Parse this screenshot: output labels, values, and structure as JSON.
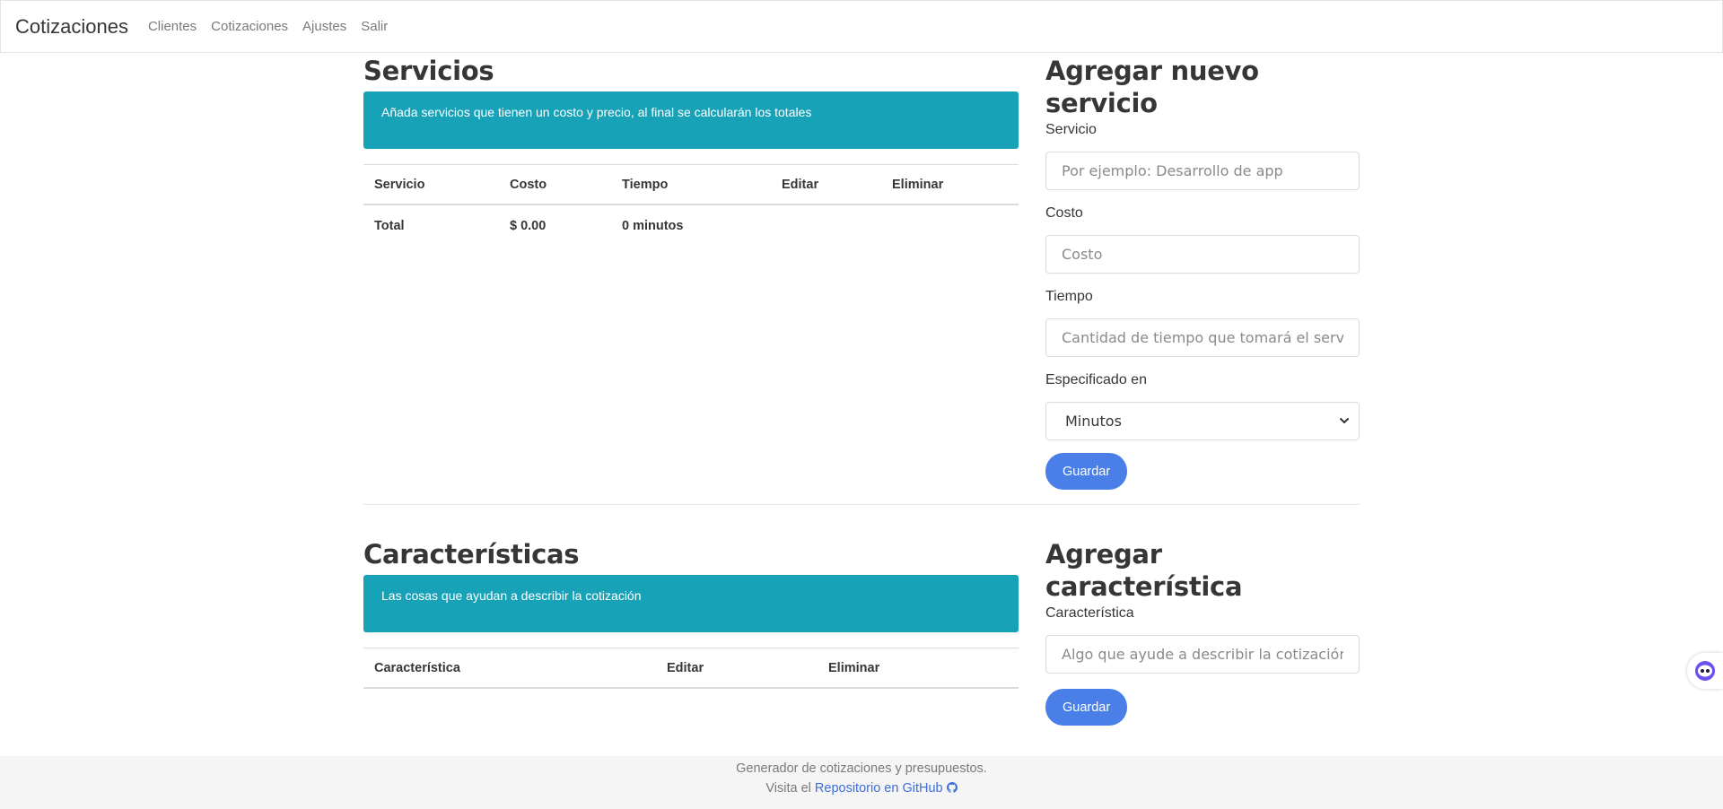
{
  "navbar": {
    "brand": "Cotizaciones",
    "links": [
      "Clientes",
      "Cotizaciones",
      "Ajustes",
      "Salir"
    ]
  },
  "services": {
    "title": "Servicios",
    "notice": "Añada servicios que tienen un costo y precio, al final se calcularán los totales",
    "columns": [
      "Servicio",
      "Costo",
      "Tiempo",
      "Editar",
      "Eliminar"
    ],
    "total_row": [
      "Total",
      "$ 0.00",
      "0 minutos"
    ]
  },
  "add_service": {
    "title": "Agregar nuevo servicio",
    "service_label": "Servicio",
    "service_placeholder": "Por ejemplo: Desarrollo de app",
    "cost_label": "Costo",
    "cost_placeholder": "Costo",
    "time_label": "Tiempo",
    "time_placeholder": "Cantidad de tiempo que tomará el servi",
    "unit_label": "Especificado en",
    "unit_value": "Minutos",
    "save_label": "Guardar"
  },
  "features": {
    "title": "Características",
    "notice": "Las cosas que ayudan a describir la cotización",
    "columns": [
      "Característica",
      "Editar",
      "Eliminar"
    ]
  },
  "add_feature": {
    "title": "Agregar característica",
    "feature_label": "Característica",
    "feature_placeholder": "Algo que ayude a describir la cotización",
    "save_label": "Guardar"
  },
  "footer": {
    "line1": "Generador de cotizaciones y presupuestos.",
    "line2_prefix": "Visita el",
    "link": "Repositorio en GitHub"
  },
  "colors": {
    "notice_bg": "#17a2b8",
    "button_bg": "#4a7fe8",
    "link": "#3e6fd8"
  },
  "icons": [
    "chevron-down-icon",
    "github-icon",
    "assistant-icon"
  ]
}
